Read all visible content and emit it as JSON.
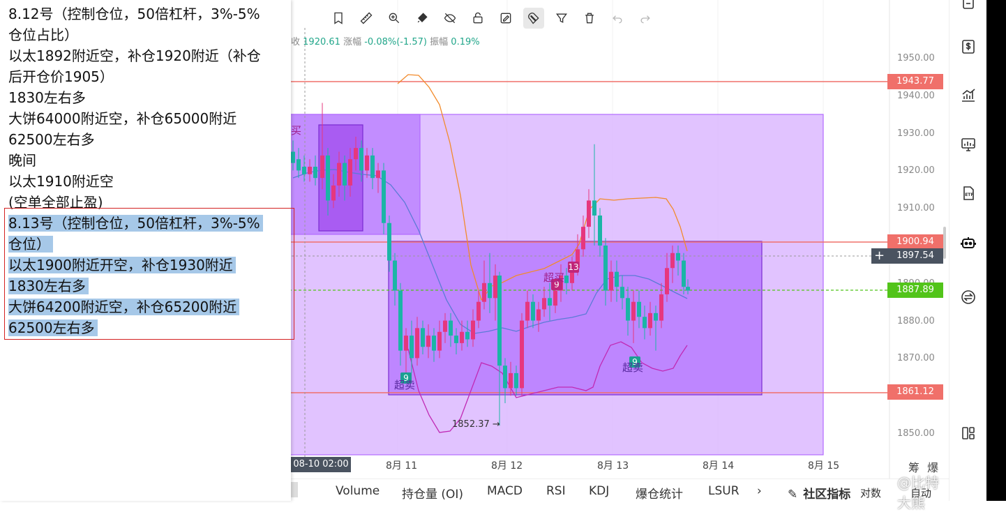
{
  "toolbar": {
    "icons": [
      "bookmark-icon",
      "ruler-icon",
      "zoom-in-icon",
      "brush-icon",
      "eye-off-icon",
      "lock-icon",
      "edit-icon",
      "magnet-icon",
      "filter-icon",
      "trash-icon",
      "undo-icon",
      "redo-icon"
    ]
  },
  "info_line": {
    "close_prefix": "收",
    "close_value": "1920.61",
    "change_label": "涨幅",
    "change_value": "-0.08%(-1.57)",
    "amp_label": "振幅",
    "amp_value": "0.19%"
  },
  "price_axis": {
    "labels": [
      "1950.00",
      "1940.00",
      "1930.00",
      "1920.00",
      "1910.00",
      "1900.00",
      "1890.00",
      "1880.00",
      "1870.00",
      "1860.00",
      "1850.00"
    ]
  },
  "price_tags": [
    {
      "value": "1943.77",
      "color": "#f0706a"
    },
    {
      "value": "1900.94",
      "color": "#f0706a"
    },
    {
      "value": "1897.54",
      "color": "#4a5360"
    },
    {
      "value": "1887.89",
      "color": "#52c41a"
    },
    {
      "value": "1861.12",
      "color": "#f0706a"
    }
  ],
  "time_axis": {
    "cursor_label": "08-10 02:00",
    "labels": [
      "8月 11",
      "8月 12",
      "8月 13",
      "8月 14",
      "8月 15"
    ]
  },
  "chart_markers": {
    "low_label": "1852.37 →",
    "buy_label": "超买",
    "sell_label": "超卖",
    "td_9": "9",
    "td_13": "13",
    "corner_label": "买"
  },
  "indicator_tabs": [
    "Volume",
    "持仓量 (OI)",
    "MACD",
    "RSI",
    "KDJ",
    "爆仓统计",
    "LSUR",
    "›"
  ],
  "indicator_right": {
    "community": "社区指标",
    "pair": "对数",
    "auto": "自动"
  },
  "axis_corner": [
    "筹",
    "爆"
  ],
  "watermark": "@比特大熊",
  "notes": {
    "lines": [
      "8.12号（控制仓位，50倍杠杆，3%-5%",
      "仓位占比）",
      "以太1892附近空，补仓1920附近（补仓",
      "后开仓价1905）",
      "1830左右多",
      "大饼64000附近空，补仓65000附近",
      "62500左右多",
      "晚间",
      "以太1910附近空",
      "(空单全部止盈)"
    ],
    "selected_lines": [
      "8.13号（控制仓位，50倍杠杆，3%-5%",
      "仓位）",
      "以太1900附近开空，补仓1930附近",
      "1830左右多",
      "大饼64200附近空，补仓65200附近",
      "62500左右多"
    ]
  },
  "colors": {
    "bull": "#e6377e",
    "bear": "#1bb5a6",
    "box": "#b26aff",
    "resistance": "#f0706a",
    "band_upper": "#f28a2a",
    "band_lower": "#c02ab5",
    "band_mid": "#5b7bd6"
  }
}
